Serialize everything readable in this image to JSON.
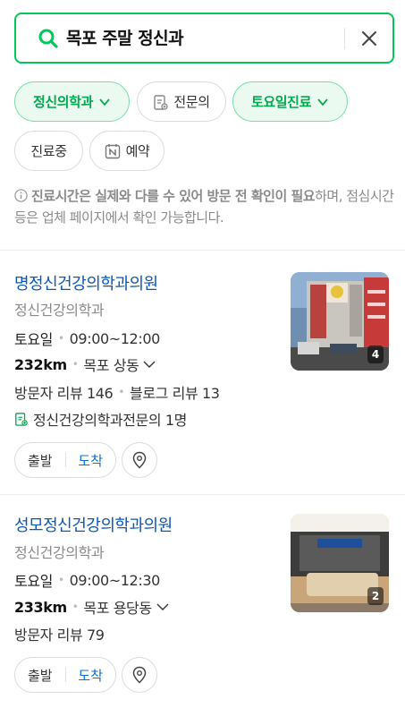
{
  "search": {
    "query": "목포 주말 정신과"
  },
  "filters": {
    "dept": "정신의학과",
    "specialist": "전문의",
    "saturday": "토요일진료",
    "open_now": "진료중",
    "reservation": "예약"
  },
  "notice": {
    "bold": "진료시간은 실제와 다를 수 있어 방문 전 확인이 필요",
    "rest": "하며, 점심시간 등은 업체 페이지에서 확인 가능합니다."
  },
  "results": [
    {
      "name": "명정신건강의학과의원",
      "category": "정신건강의학과",
      "day": "토요일",
      "hours": "09:00~12:00",
      "distance": "232km",
      "address": "목포 상동",
      "visitor_reviews": "방문자 리뷰 146",
      "blog_reviews": "블로그 리뷰 13",
      "specialists": "정신건강의학과전문의 1명",
      "photo_count": "4",
      "depart": "출발",
      "arrive": "도착"
    },
    {
      "name": "성모정신건강의학과의원",
      "category": "정신건강의학과",
      "day": "토요일",
      "hours": "09:00~12:30",
      "distance": "233km",
      "address": "목포 용당동",
      "visitor_reviews": "방문자 리뷰 79",
      "photo_count": "2",
      "depart": "출발",
      "arrive": "도착"
    }
  ],
  "colors": {
    "accent": "#03c75a",
    "link": "#0b56b8",
    "arrive": "#0b6fd8"
  }
}
